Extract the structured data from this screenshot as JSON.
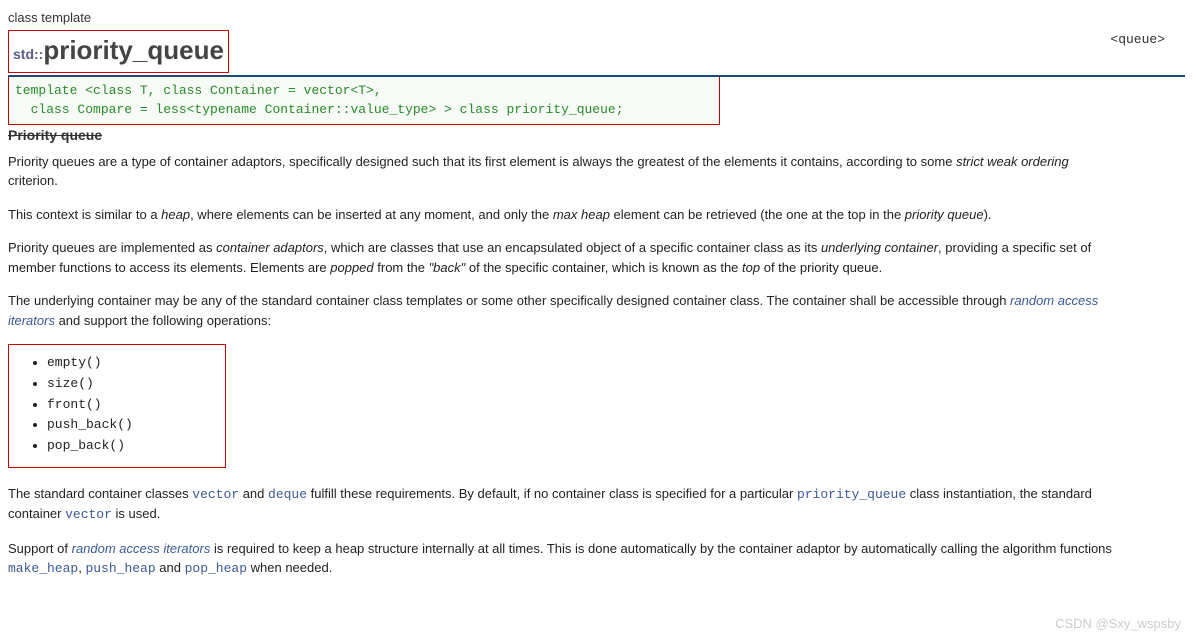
{
  "header": {
    "label": "class template",
    "namespace": "std::",
    "name": "priority_queue",
    "include": "<queue>"
  },
  "template_decl": "template <class T, class Container = vector<T>,\n  class Compare = less<typename Container::value_type> > class priority_queue;",
  "section_title": "Priority queue",
  "paragraphs": {
    "p1_a": "Priority queues are a type of container adaptors, specifically designed such that its first element is always the greatest of the elements it contains, according to some ",
    "p1_em1": "strict weak ordering",
    "p1_b": " criterion.",
    "p2_a": "This context is similar to a ",
    "p2_em1": "heap",
    "p2_b": ", where elements can be inserted at any moment, and only the ",
    "p2_em2": "max heap",
    "p2_c": " element can be retrieved (the one at the top in the ",
    "p2_em3": "priority queue",
    "p2_d": ").",
    "p3_a": "Priority queues are implemented as ",
    "p3_em1": "container adaptors",
    "p3_b": ", which are classes that use an encapsulated object of a specific container class as its ",
    "p3_em2": "underlying container",
    "p3_c": ", providing a specific set of member functions to access its elements. Elements are ",
    "p3_em3": "popped",
    "p3_d": " from the ",
    "p3_em4": "\"back\"",
    "p3_e": " of the specific container, which is known as the ",
    "p3_em5": "top",
    "p3_f": " of the priority queue.",
    "p4_a": "The underlying container may be any of the standard container class templates or some other specifically designed container class. The container shall be accessible through ",
    "p4_link": "random access iterators",
    "p4_b": " and support the following operations:",
    "p5_a": "The standard container classes ",
    "p5_c1": "vector",
    "p5_b": " and ",
    "p5_c2": "deque",
    "p5_c": " fulfill these requirements. By default, if no container class is specified for a particular ",
    "p5_c3": "priority_queue",
    "p5_d": " class instantiation, the standard container ",
    "p5_c4": "vector",
    "p5_e": " is used.",
    "p6_a": "Support of ",
    "p6_link": "random access iterators",
    "p6_b": " is required to keep a heap structure internally at all times. This is done automatically by the container adaptor by automatically calling the algorithm functions ",
    "p6_c1": "make_heap",
    "p6_c": ", ",
    "p6_c2": "push_heap",
    "p6_d": " and ",
    "p6_c3": "pop_heap",
    "p6_e": " when needed."
  },
  "operations": [
    "empty()",
    "size()",
    "front()",
    "push_back()",
    "pop_back()"
  ],
  "watermark": "CSDN @Sxy_wspsby"
}
